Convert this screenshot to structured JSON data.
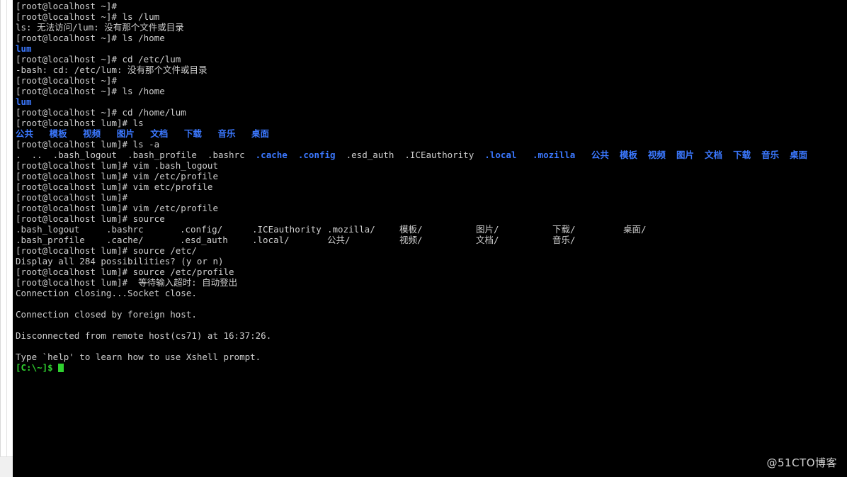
{
  "window": {
    "background_color": "#000000",
    "chrome_color": "#ffffff",
    "text_color": "#cccccc",
    "dir_color": "#3b78ff",
    "local_prompt_color": "#2fd02f"
  },
  "terminal": {
    "lines": [
      {
        "id": "l01",
        "text": "[root@localhost ~]# ",
        "class": "w"
      },
      {
        "id": "l02",
        "text": "[root@localhost ~]# ls /lum",
        "class": "w"
      },
      {
        "id": "l03",
        "text": "ls: 无法访问/lum: 没有那个文件或目录",
        "class": "w"
      },
      {
        "id": "l04",
        "text": "[root@localhost ~]# ls /home",
        "class": "w"
      },
      {
        "id": "l05",
        "text": "lum",
        "class": "blue"
      },
      {
        "id": "l06",
        "text": "[root@localhost ~]# cd /etc/lum",
        "class": "w"
      },
      {
        "id": "l07",
        "text": "-bash: cd: /etc/lum: 没有那个文件或目录",
        "class": "w"
      },
      {
        "id": "l08",
        "text": "[root@localhost ~]# ",
        "class": "w"
      },
      {
        "id": "l09",
        "text": "[root@localhost ~]# ls /home",
        "class": "w"
      },
      {
        "id": "l10",
        "text": "lum",
        "class": "blue"
      },
      {
        "id": "l11",
        "text": "[root@localhost ~]# cd /home/lum",
        "class": "w"
      },
      {
        "id": "l12",
        "text": "[root@localhost lum]# ls",
        "class": "w"
      }
    ],
    "ls_dirs_line": {
      "id": "l13",
      "text": "公共   模板   视频   图片   文档   下载   音乐   桌面",
      "class": "blue"
    },
    "lines_mid": [
      {
        "id": "l14",
        "text": "[root@localhost lum]# ls -a",
        "class": "w"
      }
    ],
    "ls_a_line": {
      "id": "l15",
      "segments": [
        {
          "text": ".  ..  .bash_logout  .bash_profile  .bashrc  ",
          "class": "w"
        },
        {
          "text": ".cache",
          "class": "blue"
        },
        {
          "text": "  ",
          "class": "w"
        },
        {
          "text": ".config",
          "class": "blue"
        },
        {
          "text": "  .esd_auth  .ICEauthority  ",
          "class": "w"
        },
        {
          "text": ".local",
          "class": "blue"
        },
        {
          "text": "   ",
          "class": "w"
        },
        {
          "text": ".mozilla",
          "class": "blue"
        },
        {
          "text": "   ",
          "class": "w"
        },
        {
          "text": "公共  模板  视频  图片  文档  下载  音乐  桌面",
          "class": "blue"
        }
      ]
    },
    "lines_after_lsa": [
      {
        "id": "l16",
        "text": "[root@localhost lum]# vim .bash_logout",
        "class": "w"
      },
      {
        "id": "l17",
        "text": "[root@localhost lum]# vim /etc/profile",
        "class": "w"
      },
      {
        "id": "l18",
        "text": "[root@localhost lum]# vim etc/profile",
        "class": "w"
      },
      {
        "id": "l19",
        "text": "[root@localhost lum]# ",
        "class": "w"
      },
      {
        "id": "l20",
        "text": "[root@localhost lum]# vim /etc/profile",
        "class": "w"
      },
      {
        "id": "l21",
        "text": "[root@localhost lum]# source",
        "class": "w"
      }
    ],
    "completion_table": {
      "column_x": [
        4,
        132,
        236,
        338,
        444,
        546,
        654,
        762,
        862
      ],
      "rows": [
        [
          ".bash_logout",
          ".bashrc",
          ".config/",
          ".ICEauthority",
          ".mozilla/",
          "模板/",
          "图片/",
          "下载/",
          "桌面/"
        ],
        [
          ".bash_profile",
          ".cache/",
          ".esd_auth",
          ".local/",
          "公共/",
          "视频/",
          "文档/",
          "音乐/",
          ""
        ]
      ]
    },
    "lines_tail": [
      {
        "id": "l24",
        "text": "[root@localhost lum]# source /etc/",
        "class": "w"
      },
      {
        "id": "l25",
        "text": "Display all 284 possibilities? (y or n)",
        "class": "w"
      },
      {
        "id": "l26",
        "text": "[root@localhost lum]# source /etc/profile",
        "class": "w"
      },
      {
        "id": "l27",
        "text": "[root@localhost lum]#  等待输入超时: 自动登出",
        "class": "w"
      },
      {
        "id": "l28",
        "text": "Connection closing...Socket close.",
        "class": "w"
      },
      {
        "id": "l29",
        "text": "",
        "class": "blank"
      },
      {
        "id": "l30",
        "text": "Connection closed by foreign host.",
        "class": "w"
      },
      {
        "id": "l31",
        "text": "",
        "class": "blank"
      },
      {
        "id": "l32",
        "text": "Disconnected from remote host(cs71) at 16:37:26.",
        "class": "w"
      },
      {
        "id": "l33",
        "text": "",
        "class": "blank"
      },
      {
        "id": "l34",
        "text": "Type `help' to learn how to use Xshell prompt.",
        "class": "w"
      }
    ],
    "local_prompt": {
      "id": "l35",
      "text": "[C:\\~]$ ",
      "class": "green"
    }
  },
  "watermark": {
    "text": "@51CTO博客"
  }
}
